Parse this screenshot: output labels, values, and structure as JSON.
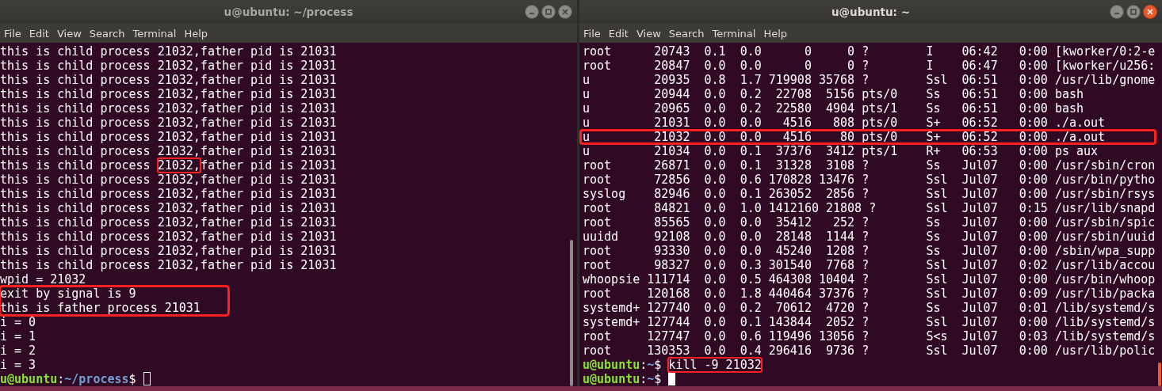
{
  "left_window": {
    "title": "u@ubuntu: ~/process",
    "active": false,
    "menu": [
      "File",
      "Edit",
      "View",
      "Search",
      "Terminal",
      "Help"
    ],
    "output": [
      {
        "kind": "line",
        "text": "this is child process 21032,father pid is 21031"
      },
      {
        "kind": "line",
        "text": "this is child process 21032,father pid is 21031"
      },
      {
        "kind": "line",
        "text": "this is child process 21032,father pid is 21031"
      },
      {
        "kind": "line",
        "text": "this is child process 21032,father pid is 21031"
      },
      {
        "kind": "line",
        "text": "this is child process 21032,father pid is 21031"
      },
      {
        "kind": "line",
        "text": "this is child process 21032,father pid is 21031"
      },
      {
        "kind": "line",
        "text": "this is child process 21032,father pid is 21031"
      },
      {
        "kind": "line",
        "text": "this is child process 21032,father pid is 21031"
      },
      {
        "kind": "marked_line",
        "before": "this is child process ",
        "marked": "21032,",
        "after": "father pid is 21031"
      },
      {
        "kind": "line",
        "text": "this is child process 21032,father pid is 21031"
      },
      {
        "kind": "line",
        "text": "this is child process 21032,father pid is 21031"
      },
      {
        "kind": "line",
        "text": "this is child process 21032,father pid is 21031"
      },
      {
        "kind": "line",
        "text": "this is child process 21032,father pid is 21031"
      },
      {
        "kind": "line",
        "text": "this is child process 21032,father pid is 21031"
      },
      {
        "kind": "line",
        "text": "this is child process 21032,father pid is 21031"
      },
      {
        "kind": "line",
        "text": "this is child process 21032,father pid is 21031"
      },
      {
        "kind": "line",
        "text": "wpid = 21032"
      },
      {
        "kind": "boxed_lines",
        "lines": [
          "exit by signal is 9",
          "this is father process 21031"
        ]
      },
      {
        "kind": "line",
        "text": "i = 0"
      },
      {
        "kind": "line",
        "text": "i = 1"
      },
      {
        "kind": "line",
        "text": "i = 2"
      },
      {
        "kind": "line",
        "text": "i = 3"
      }
    ],
    "prompts": [
      {
        "user_host": "u@ubuntu",
        "separator": ":",
        "path": "~/process",
        "symbol": "$",
        "cursor": true
      }
    ]
  },
  "right_window": {
    "title": "u@ubuntu: ~",
    "active": true,
    "menu": [
      "File",
      "Edit",
      "View",
      "Search",
      "Terminal",
      "Help"
    ],
    "ps_rows": [
      {
        "boxed": false,
        "cells": [
          "root",
          "20743",
          "0.1",
          "0.0",
          "0",
          "0",
          "?",
          "I",
          "06:42",
          "0:00",
          "[kworker/0:2-e"
        ]
      },
      {
        "boxed": false,
        "cells": [
          "root",
          "20847",
          "0.0",
          "0.0",
          "0",
          "0",
          "?",
          "I",
          "06:47",
          "0:00",
          "[kworker/u256:"
        ]
      },
      {
        "boxed": false,
        "cells": [
          "u",
          "20935",
          "0.8",
          "1.7",
          "719908",
          "35768",
          "?",
          "Ssl",
          "06:51",
          "0:00",
          "/usr/lib/gnome"
        ]
      },
      {
        "boxed": false,
        "cells": [
          "u",
          "20944",
          "0.0",
          "0.2",
          "22708",
          "5156",
          "pts/0",
          "Ss",
          "06:51",
          "0:00",
          "bash"
        ]
      },
      {
        "boxed": false,
        "cells": [
          "u",
          "20965",
          "0.0",
          "0.2",
          "22580",
          "4904",
          "pts/1",
          "Ss",
          "06:51",
          "0:00",
          "bash"
        ]
      },
      {
        "boxed": false,
        "cells": [
          "u",
          "21031",
          "0.0",
          "0.0",
          "4516",
          "808",
          "pts/0",
          "S+",
          "06:52",
          "0:00",
          "./a.out"
        ]
      },
      {
        "boxed": true,
        "cells": [
          "u",
          "21032",
          "0.0",
          "0.0",
          "4516",
          "80",
          "pts/0",
          "S+",
          "06:52",
          "0:00",
          "./a.out"
        ]
      },
      {
        "boxed": false,
        "cells": [
          "u",
          "21034",
          "0.0",
          "0.1",
          "37376",
          "3412",
          "pts/1",
          "R+",
          "06:53",
          "0:00",
          "ps aux"
        ]
      },
      {
        "boxed": false,
        "cells": [
          "root",
          "26871",
          "0.0",
          "0.1",
          "31328",
          "3108",
          "?",
          "Ss",
          "Jul07",
          "0:00",
          "/usr/sbin/cron"
        ]
      },
      {
        "boxed": false,
        "cells": [
          "root",
          "72856",
          "0.0",
          "0.6",
          "170828",
          "13476",
          "?",
          "Ssl",
          "Jul07",
          "0:00",
          "/usr/bin/pytho"
        ]
      },
      {
        "boxed": false,
        "cells": [
          "syslog",
          "82946",
          "0.0",
          "0.1",
          "263052",
          "2856",
          "?",
          "Ssl",
          "Jul07",
          "0:00",
          "/usr/sbin/rsys"
        ]
      },
      {
        "boxed": false,
        "cells": [
          "root",
          "84821",
          "0.0",
          "1.0",
          "1412160",
          "21808",
          "?",
          "Ssl",
          "Jul07",
          "0:15",
          "/usr/lib/snapd"
        ]
      },
      {
        "boxed": false,
        "cells": [
          "root",
          "85565",
          "0.0",
          "0.0",
          "35412",
          "252",
          "?",
          "Ss",
          "Jul07",
          "0:00",
          "/usr/sbin/spic"
        ]
      },
      {
        "boxed": false,
        "cells": [
          "uuidd",
          "92108",
          "0.0",
          "0.0",
          "28148",
          "1144",
          "?",
          "Ss",
          "Jul07",
          "0:00",
          "/usr/sbin/uuid"
        ]
      },
      {
        "boxed": false,
        "cells": [
          "root",
          "93330",
          "0.0",
          "0.0",
          "45240",
          "1208",
          "?",
          "Ss",
          "Jul07",
          "0:00",
          "/sbin/wpa_supp"
        ]
      },
      {
        "boxed": false,
        "cells": [
          "root",
          "98327",
          "0.0",
          "0.3",
          "301540",
          "7768",
          "?",
          "Ssl",
          "Jul07",
          "0:02",
          "/usr/lib/accou"
        ]
      },
      {
        "boxed": false,
        "cells": [
          "whoopsie",
          "111714",
          "0.0",
          "0.5",
          "464308",
          "10404",
          "?",
          "Ssl",
          "Jul07",
          "0:00",
          "/usr/bin/whoop"
        ]
      },
      {
        "boxed": false,
        "cells": [
          "root",
          "120168",
          "0.0",
          "1.8",
          "440464",
          "37376",
          "?",
          "Ssl",
          "Jul07",
          "0:09",
          "/usr/lib/packa"
        ]
      },
      {
        "boxed": false,
        "cells": [
          "systemd+",
          "127740",
          "0.0",
          "0.2",
          "70612",
          "4720",
          "?",
          "Ss",
          "Jul07",
          "0:01",
          "/lib/systemd/s"
        ]
      },
      {
        "boxed": false,
        "cells": [
          "systemd+",
          "127744",
          "0.0",
          "0.1",
          "143844",
          "2052",
          "?",
          "Ssl",
          "Jul07",
          "0:00",
          "/lib/systemd/s"
        ]
      },
      {
        "boxed": false,
        "cells": [
          "root",
          "127747",
          "0.0",
          "0.6",
          "119496",
          "13056",
          "?",
          "S<s",
          "Jul07",
          "0:03",
          "/lib/systemd/s"
        ]
      },
      {
        "boxed": false,
        "cells": [
          "root",
          "130353",
          "0.0",
          "0.4",
          "296416",
          "9736",
          "?",
          "Ssl",
          "Jul07",
          "0:00",
          "/usr/lib/polic"
        ]
      }
    ],
    "prompts": [
      {
        "user_host": "u@ubuntu",
        "separator": ":",
        "path": "~",
        "symbol": "$",
        "command": "kill -9 21032",
        "boxed": true,
        "cursor": false
      },
      {
        "user_host": "u@ubuntu",
        "separator": ":",
        "path": "~",
        "symbol": "$",
        "cursor": true
      }
    ]
  }
}
